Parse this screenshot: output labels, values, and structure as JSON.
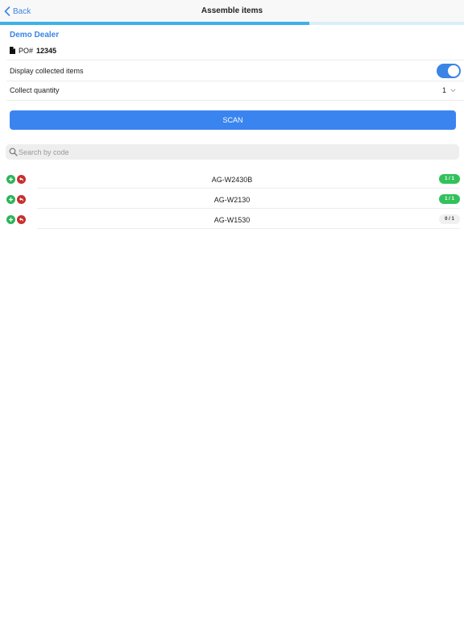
{
  "navbar": {
    "back_label": "Back",
    "title": "Assemble items"
  },
  "progress": {
    "fraction": 0.667
  },
  "order": {
    "dealer": "Demo Dealer",
    "po_prefix": "PO#",
    "po_number": "12345"
  },
  "settings": {
    "display_collected_label": "Display collected items",
    "display_collected_on": true,
    "collect_quantity_label": "Collect quantity",
    "collect_quantity_value": "1"
  },
  "scan_button_label": "SCAN",
  "search": {
    "placeholder": "Search by code",
    "value": ""
  },
  "items": [
    {
      "code": "AG-W2430B",
      "count": "1 / 1",
      "complete": true
    },
    {
      "code": "AG-W2130",
      "count": "1 / 1",
      "complete": true
    },
    {
      "code": "AG-W1530",
      "count": "0 / 1",
      "complete": false
    }
  ],
  "colors": {
    "accent": "#3a84e6",
    "progress": "#3cb2e7",
    "success": "#32c15b",
    "danger": "#c7302f"
  },
  "icons": [
    "chevron-left-icon",
    "document-icon",
    "chevron-down-icon",
    "search-icon",
    "plus-icon",
    "undo-icon"
  ]
}
